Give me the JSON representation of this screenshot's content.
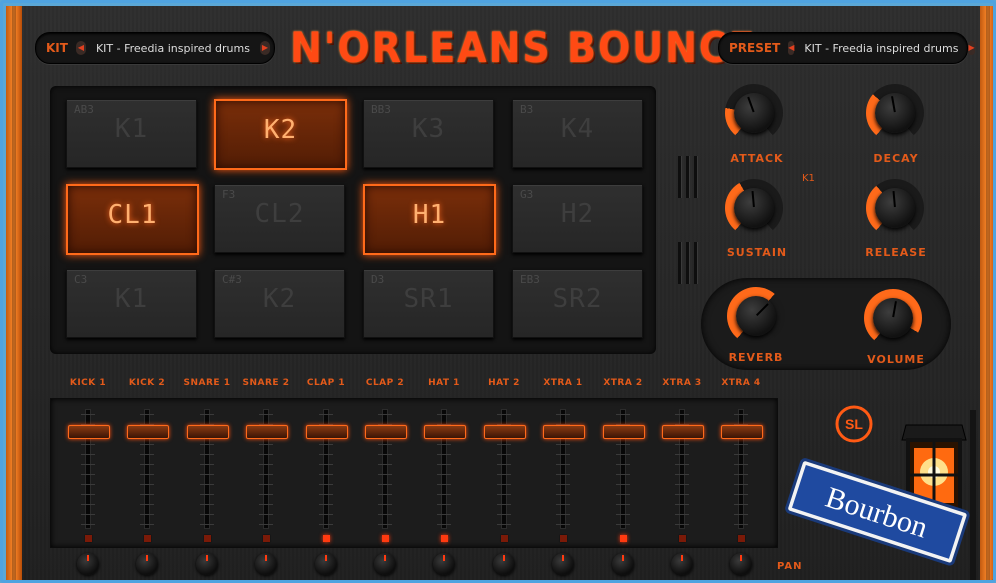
{
  "kit": {
    "tag": "KIT",
    "name": "KIT - Freedia inspired drums"
  },
  "preset": {
    "tag": "PRESET",
    "name": "KIT - Freedia inspired drums"
  },
  "title": "N'ORLEANS BOUNCE",
  "pads": [
    {
      "note": "AB3",
      "label": "K1",
      "active": false
    },
    {
      "note": "",
      "label": "K2",
      "active": true
    },
    {
      "note": "BB3",
      "label": "K3",
      "active": false
    },
    {
      "note": "B3",
      "label": "K4",
      "active": false
    },
    {
      "note": "",
      "label": "CL1",
      "active": true
    },
    {
      "note": "F3",
      "label": "CL2",
      "active": false
    },
    {
      "note": "",
      "label": "H1",
      "active": true
    },
    {
      "note": "G3",
      "label": "H2",
      "active": false
    },
    {
      "note": "C3",
      "label": "K1",
      "active": false
    },
    {
      "note": "C#3",
      "label": "K2",
      "active": false
    },
    {
      "note": "D3",
      "label": "SR1",
      "active": false
    },
    {
      "note": "EB3",
      "label": "SR2",
      "active": false
    }
  ],
  "envelope": {
    "attack": "ATTACK",
    "decay": "DECAY",
    "sustain": "SUSTAIN",
    "release": "RELEASE",
    "pad_indicator": "K1"
  },
  "fx": {
    "reverb": "REVERB",
    "volume": "VOLUME"
  },
  "channels": [
    {
      "name": "KICK 1",
      "led_on": false
    },
    {
      "name": "KICK 2",
      "led_on": false
    },
    {
      "name": "SNARE 1",
      "led_on": false
    },
    {
      "name": "SNARE 2",
      "led_on": false
    },
    {
      "name": "CLAP 1",
      "led_on": true
    },
    {
      "name": "CLAP 2",
      "led_on": true
    },
    {
      "name": "HAT 1",
      "led_on": true
    },
    {
      "name": "HAT 2",
      "led_on": false
    },
    {
      "name": "XTRA 1",
      "led_on": false
    },
    {
      "name": "XTRA 2",
      "led_on": true
    },
    {
      "name": "XTRA 3",
      "led_on": false
    },
    {
      "name": "XTRA 4",
      "led_on": false
    }
  ],
  "pan_label": "PAN",
  "logo": "SL",
  "street_sign": "Bourbon",
  "colors": {
    "accent": "#ff5a14",
    "frame": "#4fa3e0",
    "panel": "#262626"
  }
}
